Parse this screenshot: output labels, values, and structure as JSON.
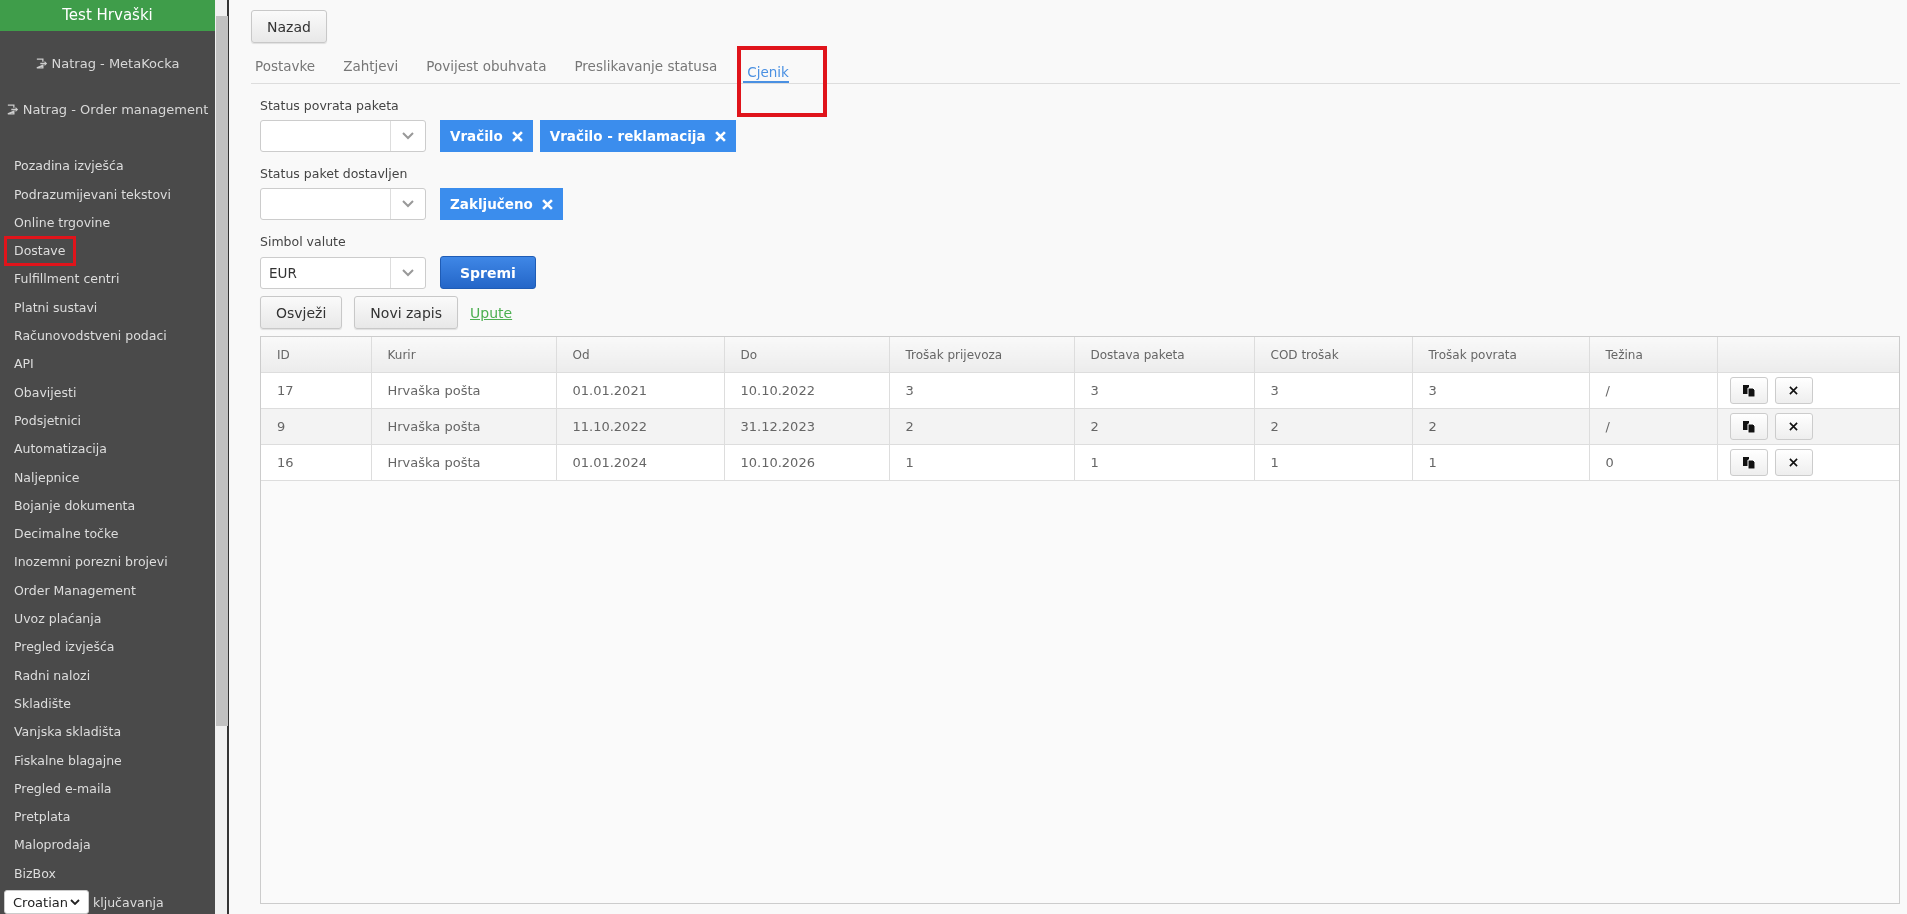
{
  "sidebar": {
    "title": "Test Hrvaški",
    "back_links": [
      {
        "label": "Natrag - MetaKocka"
      },
      {
        "label": "Natrag - Order management"
      }
    ],
    "items": [
      {
        "label": "Pozadina izvješća",
        "highlighted": false
      },
      {
        "label": "Podrazumijevani tekstovi",
        "highlighted": false
      },
      {
        "label": "Online trgovine",
        "highlighted": false
      },
      {
        "label": "Dostave",
        "highlighted": true
      },
      {
        "label": "Fulfillment centri",
        "highlighted": false
      },
      {
        "label": "Platni sustavi",
        "highlighted": false
      },
      {
        "label": "Računovodstveni podaci",
        "highlighted": false
      },
      {
        "label": "API",
        "highlighted": false
      },
      {
        "label": "Obavijesti",
        "highlighted": false
      },
      {
        "label": "Podsjetnici",
        "highlighted": false
      },
      {
        "label": "Automatizacija",
        "highlighted": false
      },
      {
        "label": "Naljepnice",
        "highlighted": false
      },
      {
        "label": "Bojanje dokumenta",
        "highlighted": false
      },
      {
        "label": "Decimalne točke",
        "highlighted": false
      },
      {
        "label": "Inozemni porezni brojevi",
        "highlighted": false
      },
      {
        "label": "Order Management",
        "highlighted": false
      },
      {
        "label": "Uvoz plaćanja",
        "highlighted": false
      },
      {
        "label": "Pregled izvješća",
        "highlighted": false
      },
      {
        "label": "Radni nalozi",
        "highlighted": false
      },
      {
        "label": "Skladište",
        "highlighted": false
      },
      {
        "label": "Vanjska skladišta",
        "highlighted": false
      },
      {
        "label": "Fiskalne blagajne",
        "highlighted": false
      },
      {
        "label": "Pregled e-maila",
        "highlighted": false
      },
      {
        "label": "Pretplata",
        "highlighted": false
      },
      {
        "label": "Maloprodaja",
        "highlighted": false
      },
      {
        "label": "BizBox",
        "highlighted": false
      }
    ],
    "last_item": {
      "label": "ključavanja",
      "highlighted": false
    },
    "language": {
      "value": "Croatian"
    }
  },
  "back_button": "Nazad",
  "tabs": [
    {
      "label": "Postavke",
      "selected": false,
      "highlighted": false
    },
    {
      "label": "Zahtjevi",
      "selected": false,
      "highlighted": false
    },
    {
      "label": "Povijest obuhvata",
      "selected": false,
      "highlighted": false
    },
    {
      "label": "Preslikavanje statusa",
      "selected": false,
      "highlighted": false
    },
    {
      "label": "Cjenik",
      "selected": true,
      "highlighted": true
    }
  ],
  "fields": [
    {
      "label": "Status povrata paketa",
      "tags": [
        "Vračilo",
        "Vračilo - reklamacija"
      ]
    },
    {
      "label": "Status paket dostavljen",
      "tags": [
        "Zaključeno"
      ]
    },
    {
      "label": "Simbol valute",
      "value": "EUR",
      "save": "Spremi"
    }
  ],
  "actions": {
    "refresh": "Osvježi",
    "new": "Novi zapis",
    "help": "Upute"
  },
  "table": {
    "columns": [
      "ID",
      "Kurir",
      "Od",
      "Do",
      "Trošak prijevoza",
      "Dostava paketa",
      "COD trošak",
      "Trošak povrata",
      "Težina"
    ],
    "rows": [
      [
        "17",
        "Hrvaška pošta",
        "01.01.2021",
        "10.10.2022",
        "3",
        "3",
        "3",
        "3",
        "/"
      ],
      [
        "9",
        "Hrvaška pošta",
        "11.10.2022",
        "31.12.2023",
        "2",
        "2",
        "2",
        "2",
        "/"
      ],
      [
        "16",
        "Hrvaška pošta",
        "01.01.2024",
        "10.10.2026",
        "1",
        "1",
        "1",
        "1",
        "0"
      ]
    ]
  }
}
